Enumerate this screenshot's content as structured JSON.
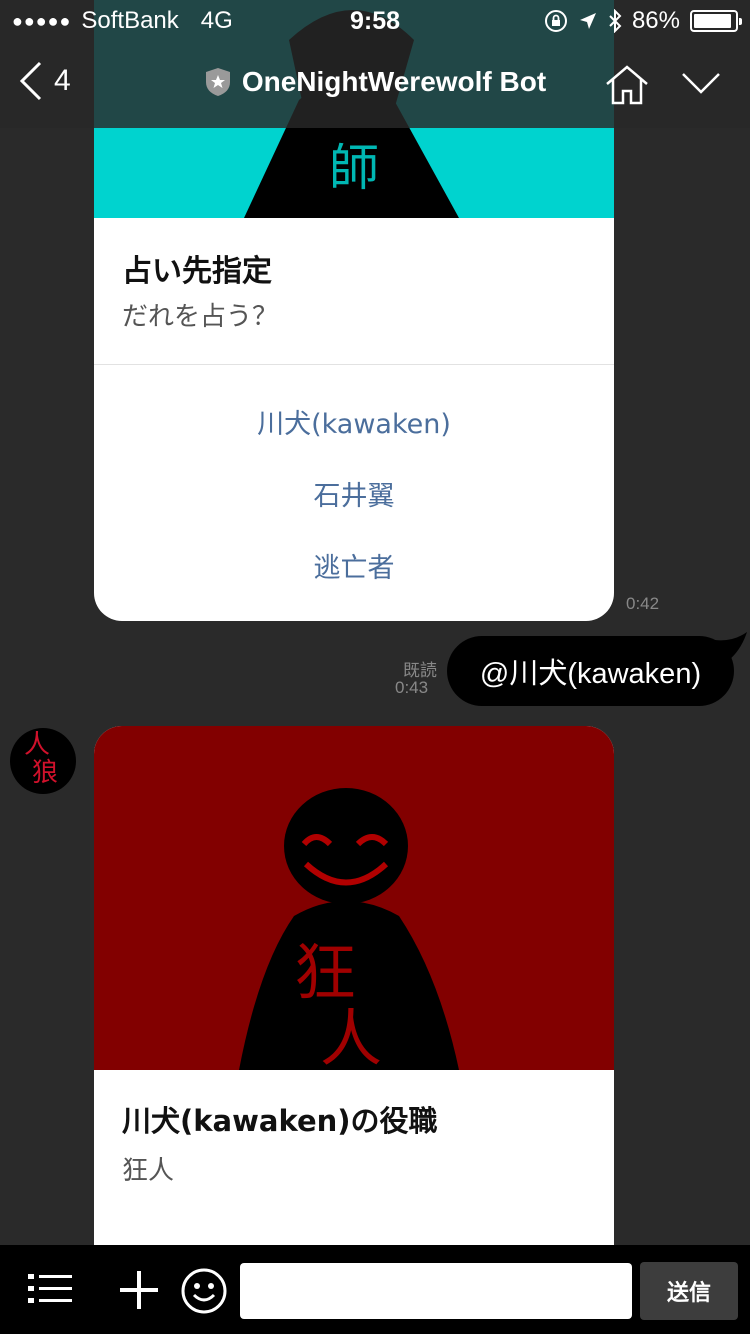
{
  "status_bar": {
    "carrier": "SoftBank",
    "network": "4G",
    "time": "9:58",
    "battery": "86%",
    "battery_level": 0.86
  },
  "header": {
    "back_count": "4",
    "title": "OneNightWerewolf Bot",
    "badge_icon": "shield-star-icon",
    "home_icon": "home-icon",
    "collapse_icon": "chevron-down-icon"
  },
  "messages": [
    {
      "type": "bot_card",
      "image_text": "師",
      "image_bg": "#00d3cf",
      "title": "占い先指定",
      "subtitle": "だれを占う？",
      "actions": [
        "川犬(kawaken)",
        "石井翼",
        "逃亡者"
      ],
      "time": "0:42"
    },
    {
      "type": "user_bubble",
      "text": "@川犬(kawaken)",
      "read_label": "既読",
      "time": "0:43"
    },
    {
      "type": "bot_card",
      "avatar_text": [
        "人",
        "狼"
      ],
      "image_text": [
        "狂",
        "人"
      ],
      "image_bg": "#820000",
      "title": "川犬(kawaken)の役職",
      "subtitle": "狂人"
    }
  ],
  "input_bar": {
    "menu_icon": "list-menu-icon",
    "plus_icon": "plus-icon",
    "emoji_icon": "smiley-icon",
    "placeholder": "",
    "send_label": "送信"
  },
  "colors": {
    "background": "#2a2a2a",
    "link": "#4b6e9c",
    "teal": "#00d3cf",
    "dark_red": "#820000"
  }
}
